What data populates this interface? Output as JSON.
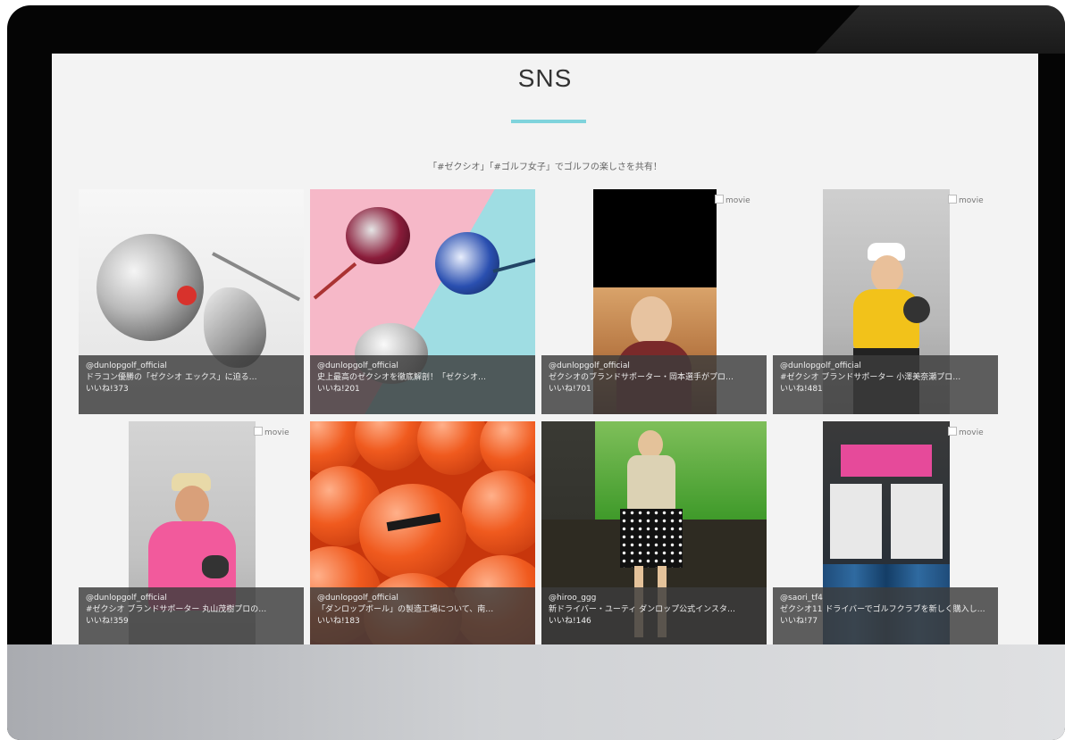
{
  "page": {
    "title": "SNS",
    "subtitle": "「#ゼクシオ」「#ゴルフ女子」でゴルフの楽しさを共有！",
    "accent_color": "#7fd3dc"
  },
  "posts": [
    {
      "account": "@dunlopgolf_official",
      "caption": "ドラコン優勝の「ゼクシオ エックス」に迫る…",
      "likes": "いいね!373",
      "badge": ""
    },
    {
      "account": "@dunlopgolf_official",
      "caption": "史上最高のゼクシオを徹底解剖！「ゼクシオ…",
      "likes": "いいね!201",
      "badge": ""
    },
    {
      "account": "@dunlopgolf_official",
      "caption": "ゼクシオのブランドサポーター・岡本選手がプロ…",
      "likes": "いいね!701",
      "badge": "movie"
    },
    {
      "account": "@dunlopgolf_official",
      "caption": "#ゼクシオ ブランドサポーター 小澤美奈瀬プロ…",
      "likes": "いいね!481",
      "badge": "movie"
    },
    {
      "account": "@dunlopgolf_official",
      "caption": "#ゼクシオ ブランドサポーター 丸山茂樹プロの…",
      "likes": "いいね!359",
      "badge": "movie"
    },
    {
      "account": "@dunlopgolf_official",
      "caption": "「ダンロップボール」の製造工場について、南…",
      "likes": "いいね!183",
      "badge": ""
    },
    {
      "account": "@hiroo_ggg",
      "caption": "新ドライバー・ユーティ ダンロップ公式インスタ…",
      "likes": "いいね!146",
      "badge": ""
    },
    {
      "account": "@saori_tf4",
      "caption": "ゼクシオ11 ドライバーでゴルフクラブを新しく購入し…",
      "likes": "いいね!77",
      "badge": "movie"
    }
  ]
}
